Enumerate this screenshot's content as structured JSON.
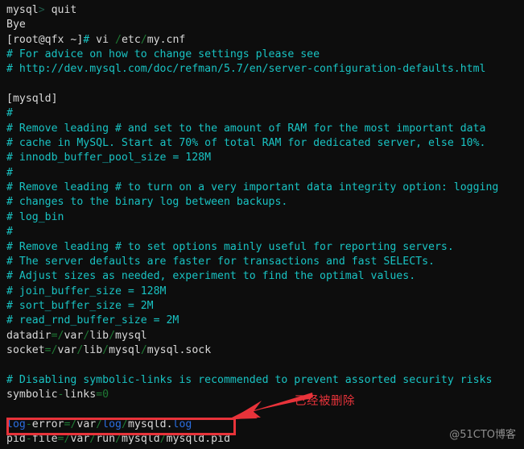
{
  "terminal": {
    "background_color": "#0d0d0d",
    "default_text_color": "#d8d8d8",
    "comment_color": "#19c3c3",
    "path_sep_color": "#1e7a34",
    "keyword_color": "#2a6ee0",
    "lines": [
      {
        "id": "line-mysql-prompt",
        "segments": [
          {
            "text": "mysql",
            "color": "white"
          },
          {
            "text": ">",
            "color": "dim"
          },
          {
            "text": " quit",
            "color": "white"
          }
        ]
      },
      {
        "id": "line-bye",
        "segments": [
          {
            "text": "Bye",
            "color": "white"
          }
        ]
      },
      {
        "id": "line-shell-prompt",
        "segments": [
          {
            "text": "[root@qfx ~]",
            "color": "white"
          },
          {
            "text": "#",
            "color": "cyan"
          },
          {
            "text": " vi ",
            "color": "white"
          },
          {
            "text": "/",
            "color": "green"
          },
          {
            "text": "etc",
            "color": "white"
          },
          {
            "text": "/",
            "color": "green"
          },
          {
            "text": "my.cnf",
            "color": "white"
          }
        ]
      },
      {
        "id": "line-comment-advice",
        "segments": [
          {
            "text": "# For advice on how to change settings please see",
            "color": "cyan"
          }
        ]
      },
      {
        "id": "line-comment-url",
        "segments": [
          {
            "text": "# http://dev.mysql.com/doc/refman/5.7/en/server-configuration-defaults.html",
            "color": "cyan"
          }
        ]
      },
      {
        "id": "line-blank-1",
        "segments": [
          {
            "text": "",
            "color": "white"
          }
        ]
      },
      {
        "id": "line-section-mysqld",
        "segments": [
          {
            "text": "[mysqld]",
            "color": "white"
          }
        ]
      },
      {
        "id": "line-hash-1",
        "segments": [
          {
            "text": "#",
            "color": "cyan"
          }
        ]
      },
      {
        "id": "line-comment-ram-1",
        "segments": [
          {
            "text": "# Remove leading # and set to the amount of RAM for the most important data",
            "color": "cyan"
          }
        ]
      },
      {
        "id": "line-comment-ram-2",
        "segments": [
          {
            "text": "# cache in MySQL. Start at 70% of total RAM for dedicated server, else 10%.",
            "color": "cyan"
          }
        ]
      },
      {
        "id": "line-comment-innodb",
        "segments": [
          {
            "text": "# innodb_buffer_pool_size = 128M",
            "color": "cyan"
          }
        ]
      },
      {
        "id": "line-hash-2",
        "segments": [
          {
            "text": "#",
            "color": "cyan"
          }
        ]
      },
      {
        "id": "line-comment-binlog-1",
        "segments": [
          {
            "text": "# Remove leading # to turn on a very important data integrity option: logging",
            "color": "cyan"
          }
        ]
      },
      {
        "id": "line-comment-binlog-2",
        "segments": [
          {
            "text": "# changes to the binary log between backups.",
            "color": "cyan"
          }
        ]
      },
      {
        "id": "line-comment-logbin",
        "segments": [
          {
            "text": "# log_bin",
            "color": "cyan"
          }
        ]
      },
      {
        "id": "line-hash-3",
        "segments": [
          {
            "text": "#",
            "color": "cyan"
          }
        ]
      },
      {
        "id": "line-comment-reporting-1",
        "segments": [
          {
            "text": "# Remove leading # to set options mainly useful for reporting servers.",
            "color": "cyan"
          }
        ]
      },
      {
        "id": "line-comment-reporting-2",
        "segments": [
          {
            "text": "# The server defaults are faster for transactions and fast SELECTs.",
            "color": "cyan"
          }
        ]
      },
      {
        "id": "line-comment-adjust",
        "segments": [
          {
            "text": "# Adjust sizes as needed, experiment to find the optimal values.",
            "color": "cyan"
          }
        ]
      },
      {
        "id": "line-comment-join",
        "segments": [
          {
            "text": "# join_buffer_size = 128M",
            "color": "cyan"
          }
        ]
      },
      {
        "id": "line-comment-sort",
        "segments": [
          {
            "text": "# sort_buffer_size = 2M",
            "color": "cyan"
          }
        ]
      },
      {
        "id": "line-comment-readrnd",
        "segments": [
          {
            "text": "# read_rnd_buffer_size = 2M",
            "color": "cyan"
          }
        ]
      },
      {
        "id": "line-datadir",
        "segments": [
          {
            "text": "datadir",
            "color": "white"
          },
          {
            "text": "=",
            "color": "green"
          },
          {
            "text": "/",
            "color": "green"
          },
          {
            "text": "var",
            "color": "white"
          },
          {
            "text": "/",
            "color": "green"
          },
          {
            "text": "lib",
            "color": "white"
          },
          {
            "text": "/",
            "color": "green"
          },
          {
            "text": "mysql",
            "color": "white"
          }
        ]
      },
      {
        "id": "line-socket",
        "segments": [
          {
            "text": "socket",
            "color": "white"
          },
          {
            "text": "=",
            "color": "green"
          },
          {
            "text": "/",
            "color": "green"
          },
          {
            "text": "var",
            "color": "white"
          },
          {
            "text": "/",
            "color": "green"
          },
          {
            "text": "lib",
            "color": "white"
          },
          {
            "text": "/",
            "color": "green"
          },
          {
            "text": "mysql",
            "color": "white"
          },
          {
            "text": "/",
            "color": "green"
          },
          {
            "text": "mysql.sock",
            "color": "white"
          }
        ]
      },
      {
        "id": "line-blank-2",
        "segments": [
          {
            "text": "",
            "color": "white"
          }
        ]
      },
      {
        "id": "line-comment-symlinks",
        "segments": [
          {
            "text": "# Disabling symbolic-links is recommended to prevent assorted security risks",
            "color": "cyan"
          }
        ]
      },
      {
        "id": "line-symbolic-links",
        "segments": [
          {
            "text": "symbolic",
            "color": "white"
          },
          {
            "text": "-",
            "color": "green"
          },
          {
            "text": "links",
            "color": "white"
          },
          {
            "text": "=",
            "color": "green"
          },
          {
            "text": "0",
            "color": "green"
          }
        ]
      },
      {
        "id": "line-blank-3",
        "segments": [
          {
            "text": "",
            "color": "white"
          }
        ]
      },
      {
        "id": "line-log-error",
        "segments": [
          {
            "text": "log",
            "color": "blue"
          },
          {
            "text": "-",
            "color": "green"
          },
          {
            "text": "error",
            "color": "white"
          },
          {
            "text": "=",
            "color": "green"
          },
          {
            "text": "/",
            "color": "green"
          },
          {
            "text": "var",
            "color": "white"
          },
          {
            "text": "/",
            "color": "green"
          },
          {
            "text": "log",
            "color": "blue"
          },
          {
            "text": "/",
            "color": "green"
          },
          {
            "text": "mysqld.",
            "color": "white"
          },
          {
            "text": "log",
            "color": "blue"
          }
        ]
      },
      {
        "id": "line-pid-file",
        "segments": [
          {
            "text": "pid",
            "color": "white"
          },
          {
            "text": "-",
            "color": "green"
          },
          {
            "text": "file",
            "color": "white"
          },
          {
            "text": "=",
            "color": "green"
          },
          {
            "text": "/",
            "color": "green"
          },
          {
            "text": "var",
            "color": "white"
          },
          {
            "text": "/",
            "color": "green"
          },
          {
            "text": "run",
            "color": "white"
          },
          {
            "text": "/",
            "color": "green"
          },
          {
            "text": "mysqld",
            "color": "white"
          },
          {
            "text": "/",
            "color": "green"
          },
          {
            "text": "mysqld.pid",
            "color": "white"
          }
        ]
      }
    ]
  },
  "annotations": {
    "highlight_color": "#e8333a",
    "note_text": "已经被删除",
    "arrow_name": "red-arrow-pointing-left-down",
    "box_name": "red-highlight-box-empty-line"
  },
  "watermark": {
    "text": "@51CTO博客"
  }
}
